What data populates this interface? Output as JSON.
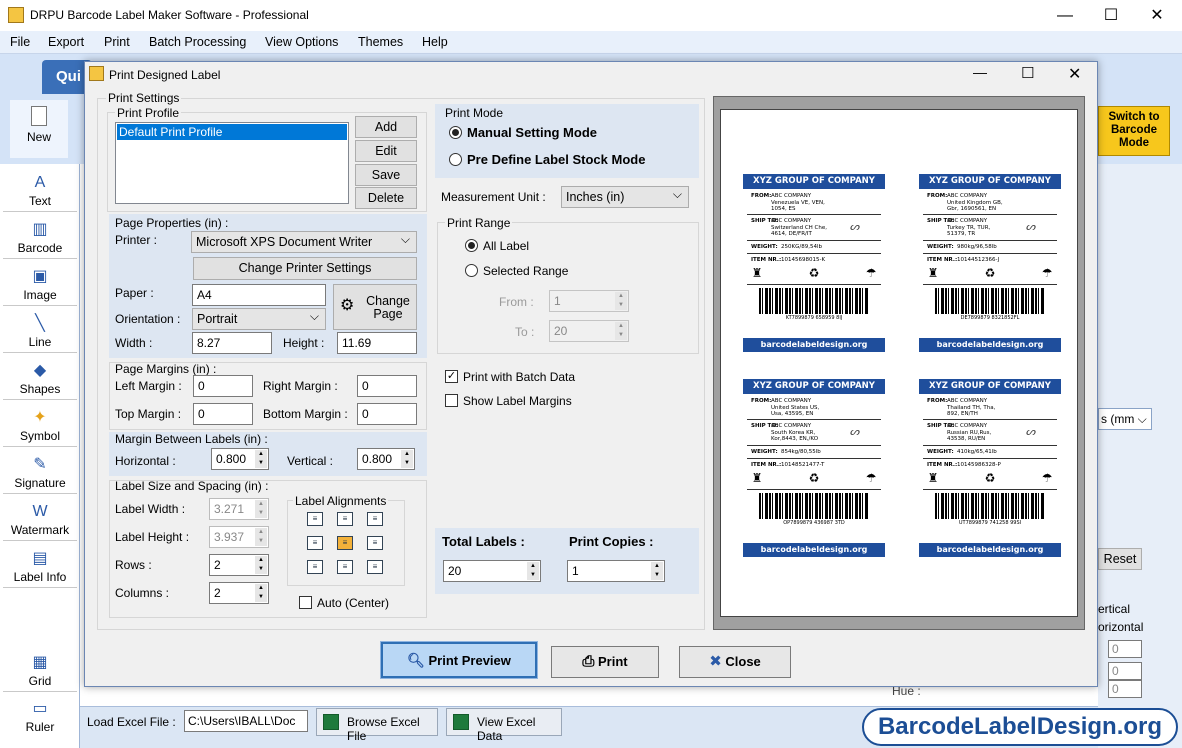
{
  "app": {
    "title": "DRPU Barcode Label Maker Software - Professional"
  },
  "menu": [
    "File",
    "Export",
    "Print",
    "Batch Processing",
    "View Options",
    "Themes",
    "Help"
  ],
  "ribbon": {
    "tab": "Qui",
    "new_label": "New",
    "switch_label": "Switch to Barcode Mode"
  },
  "toolbox": [
    {
      "label": "Text",
      "icon": "text-icon"
    },
    {
      "label": "Barcode",
      "icon": "barcode-icon"
    },
    {
      "label": "Image",
      "icon": "image-icon"
    },
    {
      "label": "Line",
      "icon": "line-icon"
    },
    {
      "label": "Shapes",
      "icon": "shapes-icon"
    },
    {
      "label": "Symbol",
      "icon": "symbol-icon"
    },
    {
      "label": "Signature",
      "icon": "signature-icon"
    },
    {
      "label": "Watermark",
      "icon": "watermark-icon"
    },
    {
      "label": "Label Info",
      "icon": "label-info-icon"
    },
    {
      "label": "Grid",
      "icon": "grid-icon"
    },
    {
      "label": "Ruler",
      "icon": "ruler-icon"
    }
  ],
  "right_panel": {
    "units": "s (mm",
    "reset": "Reset",
    "vertical": "ertical",
    "horizontal": "orizontal",
    "hue": "Hue :",
    "zero": "0"
  },
  "bottom": {
    "excel_label": "Load Excel File :",
    "excel_path": "C:\\Users\\IBALL\\Doc",
    "browse": "Browse Excel File",
    "view": "View Excel Data",
    "brand": "BarcodeLabelDesign.org"
  },
  "dialog": {
    "title": "Print Designed Label",
    "print_settings": "Print Settings",
    "print_profile": {
      "label": "Print Profile",
      "items": [
        "Default Print Profile"
      ],
      "buttons": [
        "Add",
        "Edit",
        "Save",
        "Delete"
      ]
    },
    "page_properties": {
      "label": "Page Properties (in) :",
      "printer_label": "Printer :",
      "printer": "Microsoft XPS Document Writer",
      "change_printer": "Change Printer Settings",
      "paper_label": "Paper :",
      "paper": "A4",
      "change_page": "Change Page",
      "orientation_label": "Orientation :",
      "orientation": "Portrait",
      "width_label": "Width :",
      "width": "8.27",
      "height_label": "Height :",
      "height": "11.69"
    },
    "page_margins": {
      "label": "Page Margins (in) :",
      "left_label": "Left Margin :",
      "left": "0",
      "right_label": "Right Margin :",
      "right": "0",
      "top_label": "Top Margin :",
      "top": "0",
      "bottom_label": "Bottom Margin :",
      "bottom": "0"
    },
    "margin_between": {
      "label": "Margin Between Labels (in) :",
      "horizontal_label": "Horizontal :",
      "horizontal": "0.800",
      "vertical_label": "Vertical :",
      "vertical": "0.800"
    },
    "label_size": {
      "label": "Label Size and Spacing (in) :",
      "width_label": "Label Width :",
      "width": "3.271",
      "height_label": "Label Height :",
      "height": "3.937",
      "rows_label": "Rows :",
      "rows": "2",
      "columns_label": "Columns :",
      "columns": "2",
      "alignments_label": "Label Alignments",
      "auto_center": "Auto (Center)"
    },
    "print_mode": {
      "label": "Print Mode",
      "manual": "Manual Setting Mode",
      "predefine": "Pre Define Label Stock Mode"
    },
    "measurement": {
      "label": "Measurement Unit :",
      "value": "Inches (in)"
    },
    "print_range": {
      "label": "Print Range",
      "all": "All Label",
      "selected": "Selected Range",
      "from_label": "From :",
      "from": "1",
      "to_label": "To :",
      "to": "20"
    },
    "batch": "Print with Batch Data",
    "show_margins": "Show Label Margins",
    "total_labels_label": "Total Labels :",
    "total_labels": "20",
    "print_copies_label": "Print Copies :",
    "print_copies": "1",
    "buttons": {
      "preview": "Print Preview",
      "print": "Print",
      "close": "Close"
    }
  },
  "labels": [
    {
      "header": "XYZ GROUP OF COMPANY",
      "from": "FROM:",
      "from_lines": [
        "ABC COMPANY",
        "Venezuela VE, VEN,",
        "1054, ES"
      ],
      "ship": "SHIP TO:",
      "ship_lines": [
        "ABC COMPANY",
        "Switzerland CH Che,",
        "4614, DE/FR/IT"
      ],
      "weight_label": "WEIGHT:",
      "weight": "250KG/89,54lb",
      "item_label": "ITEM NR.:",
      "item": "10145698015-K",
      "code": "KT7899879 658959 8IJ",
      "footer": "barcodelabeldesign.org"
    },
    {
      "header": "XYZ GROUP OF COMPANY",
      "from": "FROM:",
      "from_lines": [
        "ABC COMPANY",
        "United Kingdom GB,",
        "Gbr, 1690561, EN"
      ],
      "ship": "SHIP TO:",
      "ship_lines": [
        "ABC COMPANY",
        "Turkey TR, TUR,",
        "51379, TR"
      ],
      "weight_label": "WEIGHT:",
      "weight": "980kg/96,58lb",
      "item_label": "ITEM NR.:",
      "item": "10144512366-J",
      "code": "DE7899879 8321852FL",
      "footer": "barcodelabeldesign.org"
    },
    {
      "header": "XYZ GROUP OF COMPANY",
      "from": "FROM:",
      "from_lines": [
        "ABC COMPANY",
        "United States US,",
        "Usa, 43595, EN"
      ],
      "ship": "SHIP TO:",
      "ship_lines": [
        "ABC COMPANY",
        "South Korea KR,",
        "Kor,8443, EN,/KO"
      ],
      "weight_label": "WEIGHT:",
      "weight": "854kg/80,55lb",
      "item_label": "ITEM NR.:",
      "item": "10148521477-T",
      "code": "OP7899879 436987 3TD",
      "footer": "barcodelabeldesign.org"
    },
    {
      "header": "XYZ GROUP OF COMPANY",
      "from": "FROM:",
      "from_lines": [
        "ABC COMPANY",
        "Thailand TH, Tha,",
        "892, EN/TH"
      ],
      "ship": "SHIP TO:",
      "ship_lines": [
        "ABC COMPANY",
        "Russian RU,Rus,",
        "43538, RU/EN"
      ],
      "weight_label": "WEIGHT:",
      "weight": "410kg/65,41lb",
      "item_label": "ITEM NR.:",
      "item": "10145986328-P",
      "code": "UT7899879 741258 99SI",
      "footer": "barcodelabeldesign.org"
    }
  ]
}
